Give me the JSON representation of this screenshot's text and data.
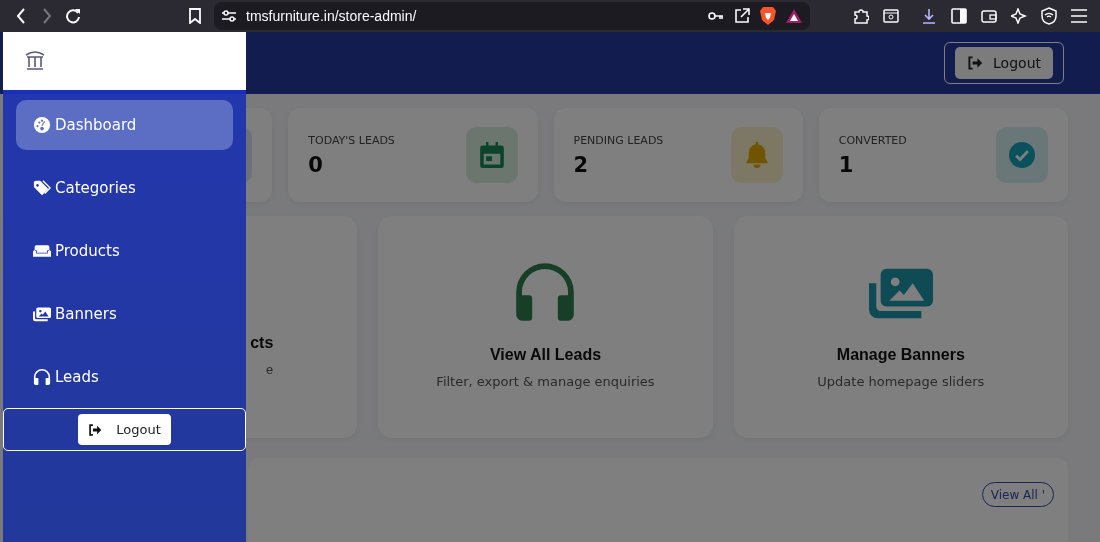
{
  "browser": {
    "url": "tmsfurniture.in/store-admin/"
  },
  "header": {
    "logout": "Logout"
  },
  "sidebar": {
    "items": [
      {
        "label": "Dashboard",
        "selected": true
      },
      {
        "label": "Categories",
        "selected": false
      },
      {
        "label": "Products",
        "selected": false
      },
      {
        "label": "Banners",
        "selected": false
      },
      {
        "label": "Leads",
        "selected": false
      }
    ],
    "logout": "Logout"
  },
  "stats": [
    {
      "label": "TODAY'S LEADS",
      "value": "0"
    },
    {
      "label": "PENDING LEADS",
      "value": "2"
    },
    {
      "label": "CONVERTED",
      "value": "1"
    }
  ],
  "actions": [
    {
      "kind": "partial",
      "title": "cts",
      "subtitle": "e"
    },
    {
      "kind": "full",
      "title": "View All Leads",
      "subtitle": "Filter, export & manage enquiries"
    },
    {
      "kind": "full",
      "title": "Manage Banners",
      "subtitle": "Update homepage sliders"
    }
  ],
  "recent": {
    "button": "View All '"
  }
}
